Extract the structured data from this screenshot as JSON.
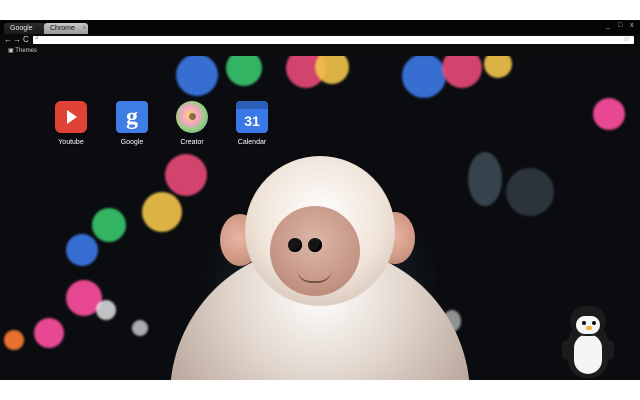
{
  "browser": {
    "tabs": [
      {
        "label": "Google",
        "active": true
      },
      {
        "label": "Chrome",
        "active": false
      }
    ],
    "window_controls": {
      "minimize": "_",
      "maximize": "□",
      "close": "x"
    },
    "toolbar": {
      "back": "←",
      "forward": "→",
      "reload": "C",
      "omnibox_value": "",
      "omnibox_prefix_icon": "search-icon",
      "star_icon": "star-icon"
    },
    "bookmarks_bar": {
      "items": [
        {
          "label": "Themes"
        }
      ]
    }
  },
  "apps": [
    {
      "label": "Youtube",
      "icon": "youtube-icon"
    },
    {
      "label": "Google",
      "icon": "google-icon"
    },
    {
      "label": "Creator",
      "icon": "creator-icon"
    },
    {
      "label": "Calendar",
      "icon": "calendar-icon",
      "badge": "31"
    }
  ],
  "background": {
    "accent_colors": [
      "#e84b78",
      "#38c76b",
      "#f3c54a",
      "#3b79e8",
      "#ff4fa0",
      "#ffffff"
    ]
  }
}
